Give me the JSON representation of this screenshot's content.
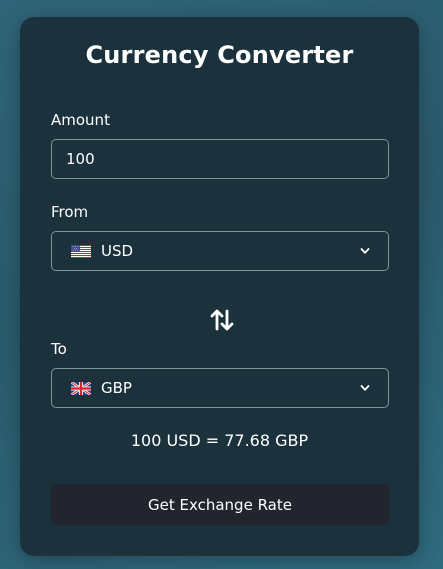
{
  "app": {
    "title": "Currency Converter"
  },
  "amount": {
    "label": "Amount",
    "value": "100"
  },
  "from": {
    "label": "From",
    "currency": "USD",
    "flag_icon": "us-flag-icon"
  },
  "to": {
    "label": "To",
    "currency": "GBP",
    "flag_icon": "uk-flag-icon"
  },
  "swap": {
    "icon": "swap-arrows-icon"
  },
  "result": {
    "text": "100 USD = 77.68 GBP"
  },
  "button": {
    "label": "Get Exchange Rate"
  },
  "colors": {
    "background": "#2c5f72",
    "card": "#1b323c",
    "field_border": "#7d929a",
    "button": "#23252e",
    "text": "#ffffff"
  }
}
